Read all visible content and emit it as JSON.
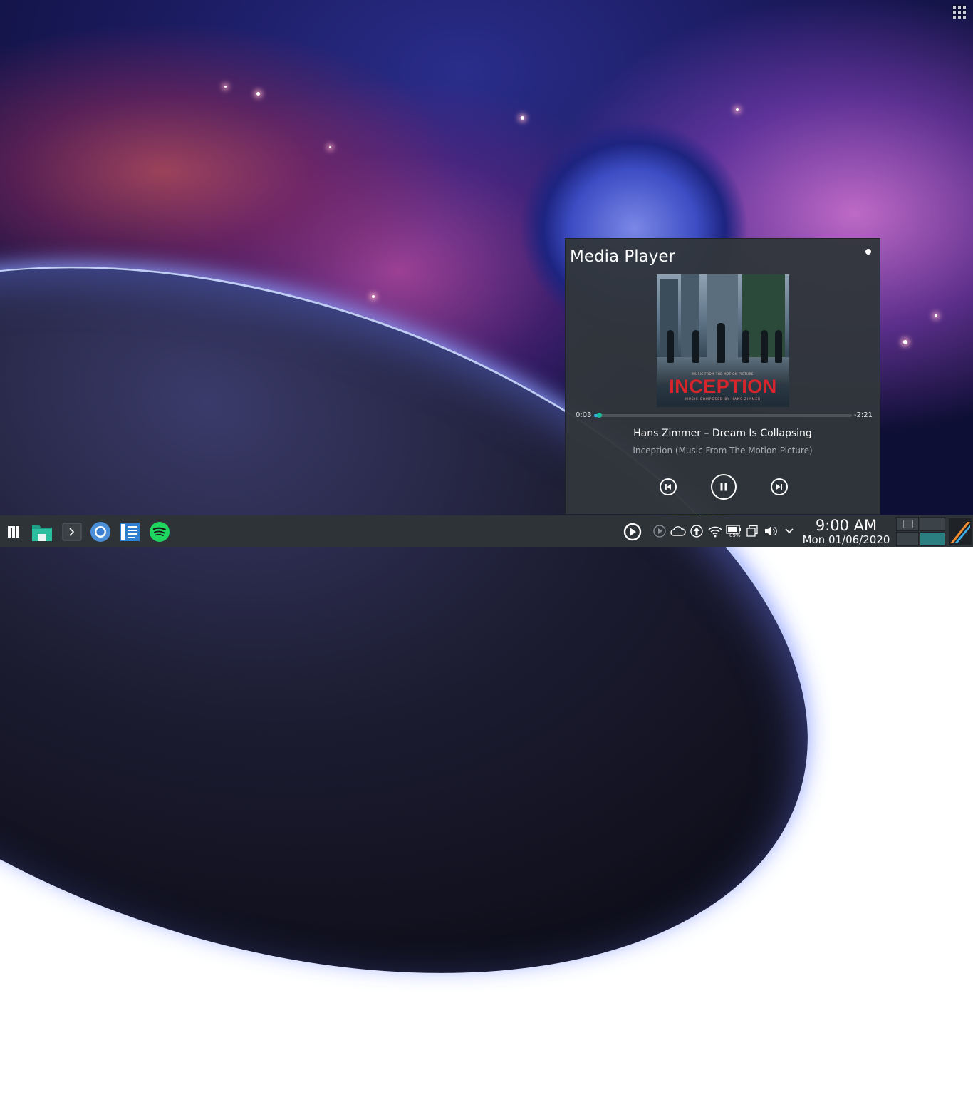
{
  "desktop": {
    "grid_button_icon": "app-grid-icon"
  },
  "media_player": {
    "title": "Media Player",
    "pin_icon": "pin-dot-icon",
    "cover": {
      "small_text": "MUSIC FROM THE MOTION PICTURE",
      "big_title": "INCEPTION",
      "composer_text": "MUSIC COMPOSED BY HANS ZIMMER"
    },
    "position": "0:03",
    "remaining": "-2:21",
    "progress_fraction": 0.02,
    "song": "Hans Zimmer – Dream Is Collapsing",
    "album": "Inception (Music From The Motion Picture)",
    "controls": [
      "previous-track-icon",
      "pause-icon",
      "next-track-icon"
    ],
    "accent_color": "#1abc9c"
  },
  "taskbar": {
    "launchers": [
      {
        "name": "application-launcher-icon"
      },
      {
        "name": "file-manager-icon"
      },
      {
        "name": "terminal-icon"
      },
      {
        "name": "chromium-browser-icon"
      },
      {
        "name": "text-editor-icon"
      },
      {
        "name": "spotify-icon"
      }
    ],
    "tray": [
      {
        "name": "media-player-tray-icon"
      },
      {
        "name": "media-play-small-icon"
      },
      {
        "name": "cloud-sync-icon"
      },
      {
        "name": "updates-icon"
      },
      {
        "name": "wifi-icon"
      },
      {
        "name": "battery-icon",
        "label": "89%"
      },
      {
        "name": "clipboard-icon"
      },
      {
        "name": "volume-icon"
      },
      {
        "name": "tray-expand-chevron-icon"
      }
    ],
    "clock": {
      "time": "9:00 AM",
      "date": "Mon 01/06/2020"
    },
    "pager_desktops": 4,
    "pager_active": 4,
    "show_desktop_icon": "show-desktop-icon"
  }
}
